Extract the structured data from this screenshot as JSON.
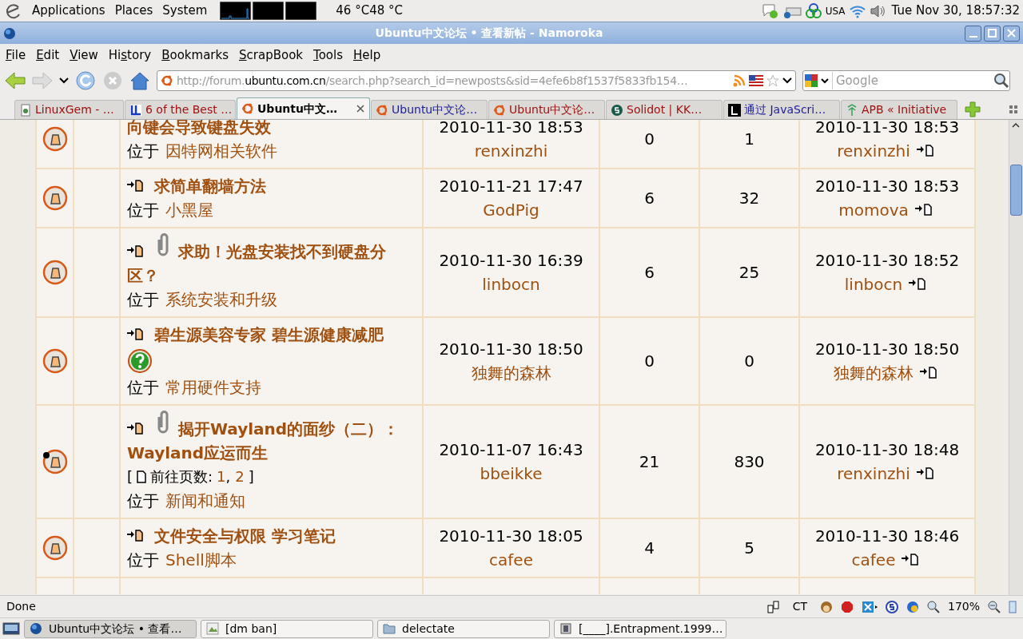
{
  "panel": {
    "menus": [
      "Applications",
      "Places",
      "System"
    ],
    "temps": [
      "46 °C",
      "48 °C"
    ],
    "keyboard": "USA",
    "clock": "Tue Nov 30, 18:57:32"
  },
  "window": {
    "title": "Ubuntu中文论坛 • 查看新帖 - Namoroka"
  },
  "menubar": [
    {
      "key": "F",
      "rest": "ile"
    },
    {
      "key": "E",
      "rest": "dit"
    },
    {
      "key": "V",
      "rest": "iew"
    },
    {
      "pre": "Hi",
      "key": "s",
      "rest": "tory"
    },
    {
      "key": "B",
      "rest": "ookmarks"
    },
    {
      "key": "S",
      "rest": "crapBook"
    },
    {
      "key": "T",
      "rest": "ools"
    },
    {
      "key": "H",
      "rest": "elp"
    }
  ],
  "address": {
    "pre": "http://forum.",
    "host": "ubuntu.com.cn",
    "post": "/search.php?search_id=newposts&sid=4efe6b8f1537f5833fb154…"
  },
  "search": {
    "placeholder": "Google"
  },
  "tabs": [
    {
      "label": "LinuxGem - …",
      "selected": false,
      "color": "#a01010"
    },
    {
      "label": "6 of the Best …",
      "selected": false,
      "color": "#a01010"
    },
    {
      "label": "Ubuntu中文…",
      "selected": true,
      "color": "#000000"
    },
    {
      "label": "Ubuntu中文论…",
      "selected": false,
      "color": "#1a1aa0"
    },
    {
      "label": "Ubuntu中文论…",
      "selected": false,
      "color": "#a01010"
    },
    {
      "label": "Solidot | KK…",
      "selected": false,
      "color": "#a01010"
    },
    {
      "label": "通过 JavaScri…",
      "selected": false,
      "color": "#1a1aa0"
    },
    {
      "label": "APB « Initiative",
      "selected": false,
      "color": "#a01010"
    }
  ],
  "topics": [
    {
      "hot": false,
      "new_marker": false,
      "attachment": false,
      "question": false,
      "title": "向键会导致键盘失效",
      "forum_prefix": "位于",
      "forum": "因特网相关软件",
      "first_date": "2010-11-30 18:53",
      "author": "renxinzhi",
      "replies": "0",
      "views": "1",
      "last_date": "2010-11-30 18:53",
      "last_author": "renxinzhi"
    },
    {
      "hot": false,
      "new_marker": true,
      "attachment": false,
      "question": false,
      "title": "求简单翻墙方法",
      "forum_prefix": "位于",
      "forum": "小黑屋",
      "first_date": "2010-11-21 17:47",
      "author": "GodPig",
      "replies": "6",
      "views": "32",
      "last_date": "2010-11-30 18:53",
      "last_author": "momova"
    },
    {
      "hot": false,
      "new_marker": true,
      "attachment": true,
      "question": false,
      "title": "求助！光盘安装找不到硬盘分区？",
      "forum_prefix": "位于",
      "forum": "系统安装和升级",
      "first_date": "2010-11-30 16:39",
      "author": "linbocn",
      "replies": "6",
      "views": "25",
      "last_date": "2010-11-30 18:52",
      "last_author": "linbocn"
    },
    {
      "hot": false,
      "new_marker": true,
      "attachment": false,
      "question": true,
      "title": "碧生源美容专家 碧生源健康减肥",
      "forum_prefix": "位于",
      "forum": "常用硬件支持",
      "first_date": "2010-11-30 18:50",
      "author": "独舞的森林",
      "replies": "0",
      "views": "0",
      "last_date": "2010-11-30 18:50",
      "last_author": "独舞的森林"
    },
    {
      "hot": true,
      "new_marker": true,
      "attachment": true,
      "question": false,
      "title": "揭开Wayland的面纱（二）：Wayland应运而生",
      "pages": {
        "open": "[",
        "label": "前往页数:",
        "links": [
          "1",
          "2"
        ],
        "separator": ",",
        "close": "]"
      },
      "forum_prefix": "位于",
      "forum": "新闻和通知",
      "first_date": "2010-11-07 16:43",
      "author": "bbeikke",
      "replies": "21",
      "views": "830",
      "last_date": "2010-11-30 18:48",
      "last_author": "renxinzhi"
    },
    {
      "hot": false,
      "new_marker": true,
      "attachment": false,
      "question": false,
      "title": "文件安全与权限 学习笔记",
      "forum_prefix": "位于",
      "forum": "Shell脚本",
      "first_date": "2010-11-30 18:05",
      "author": "cafee",
      "replies": "4",
      "views": "5",
      "last_date": "2010-11-30 18:46",
      "last_author": "cafee"
    }
  ],
  "status_bar": {
    "text": "Done",
    "encoding": "CT",
    "zoom": "170%"
  },
  "taskbar": [
    {
      "label": "Ubuntu中文论坛 • 查看…",
      "selected": true
    },
    {
      "label": "[dm ban]",
      "selected": false
    },
    {
      "label": "delectate",
      "selected": false
    },
    {
      "label": "[____].Entrapment.1999…",
      "selected": false
    }
  ]
}
